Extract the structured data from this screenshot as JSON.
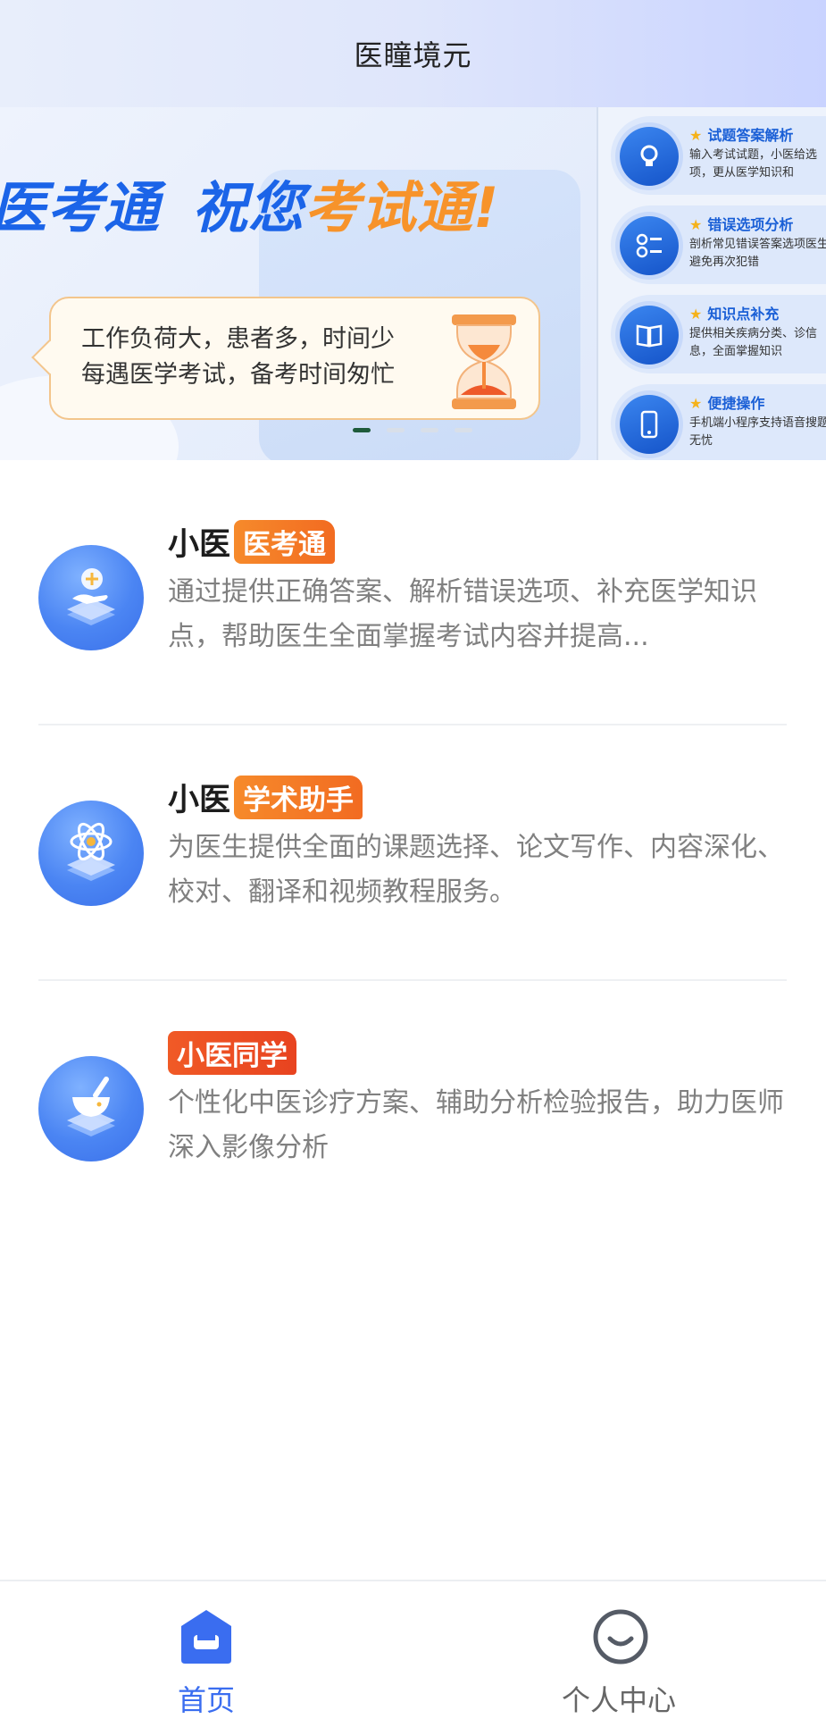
{
  "header": {
    "title": "医瞳境元"
  },
  "banner": {
    "slogan_part1": "医考通",
    "slogan_part2": "祝您",
    "slogan_part3": "考试通!",
    "bubble_line1": "工作负荷大，患者多，时间少",
    "bubble_line2": "每遇医学考试，备考时间匆忙",
    "features": [
      {
        "title": "试题答案解析",
        "desc": "输入考试试题，小医给选项，更从医学知识和"
      },
      {
        "title": "错误选项分析",
        "desc": "剖析常见错误答案选项医生避免再次犯错"
      },
      {
        "title": "知识点补充",
        "desc": "提供相关疾病分类、诊信息，全面掌握知识"
      },
      {
        "title": "便捷操作",
        "desc": "手机端小程序支持语音搜题无忧"
      }
    ],
    "slide_count": 4,
    "active_slide": 1
  },
  "services": [
    {
      "prefix": "小医",
      "tag": "医考通",
      "desc": "通过提供正确答案、解析错误选项、补充医学知识点，帮助医生全面掌握考试内容并提高..."
    },
    {
      "prefix": "小医",
      "tag": "学术助手",
      "desc": "为医生提供全面的课题选择、论文写作、内容深化、校对、翻译和视频教程服务。"
    },
    {
      "prefix": "",
      "tag": "小医同学",
      "desc": "个性化中医诊疗方案、辅助分析检验报告，助力医师深入影像分析"
    }
  ],
  "tabbar": {
    "home_label": "首页",
    "me_label": "个人中心",
    "active": "首页"
  },
  "colors": {
    "accent": "#3a6df0",
    "tag_orange": "#f37a26",
    "tag_red": "#e84320"
  }
}
